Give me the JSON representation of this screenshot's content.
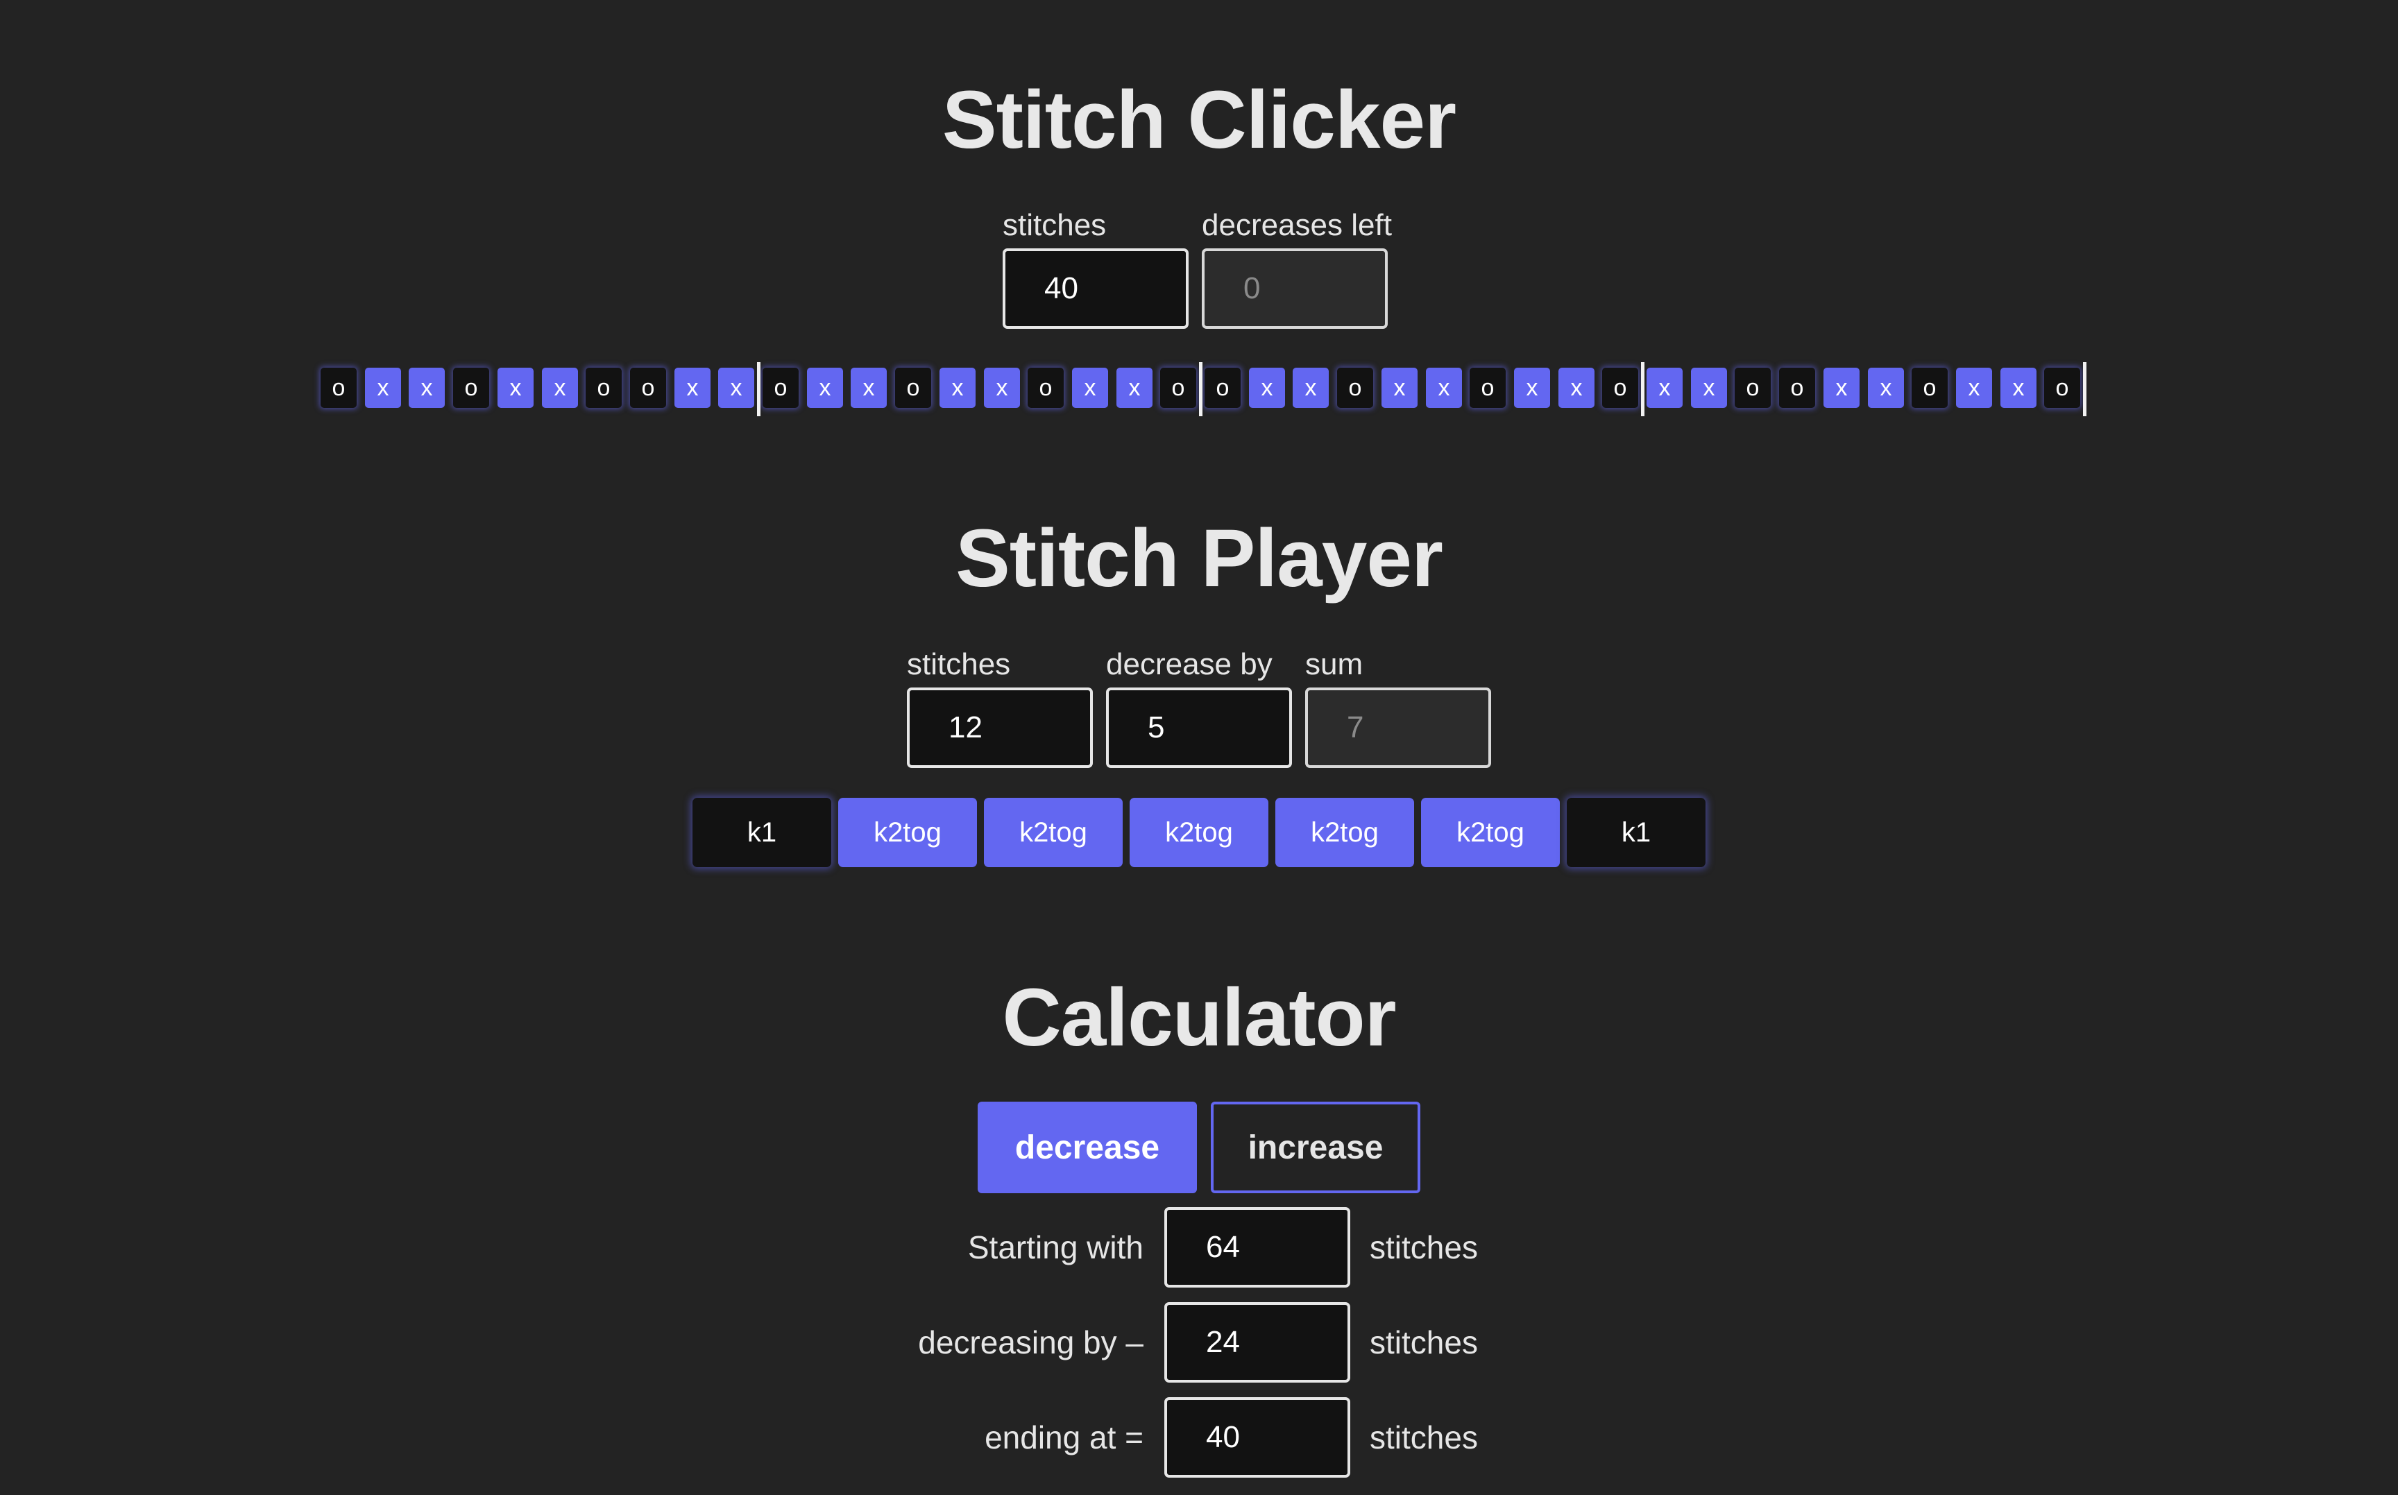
{
  "clicker": {
    "title": "Stitch Clicker",
    "stitches_label": "stitches",
    "stitches_value": "40",
    "decreases_label": "decreases left",
    "decreases_value": "0",
    "row": [
      "o",
      "x",
      "x",
      "o",
      "x",
      "x",
      "o",
      "o",
      "x",
      "x",
      "o",
      "x",
      "x",
      "o",
      "x",
      "x",
      "o",
      "x",
      "x",
      "o",
      "o",
      "x",
      "x",
      "o",
      "x",
      "x",
      "o",
      "x",
      "x",
      "o",
      "x",
      "x",
      "o",
      "o",
      "x",
      "x",
      "o",
      "x",
      "x",
      "o"
    ],
    "divider_after": [
      10,
      20,
      30,
      40
    ]
  },
  "player": {
    "title": "Stitch Player",
    "stitches_label": "stitches",
    "stitches_value": "12",
    "decrease_label": "decrease by",
    "decrease_value": "5",
    "sum_label": "sum",
    "sum_value": "7",
    "steps": [
      "k1",
      "k2tog",
      "k2tog",
      "k2tog",
      "k2tog",
      "k2tog",
      "k1"
    ]
  },
  "calculator": {
    "title": "Calculator",
    "mode_decrease": "decrease",
    "mode_increase": "increase",
    "rows": [
      {
        "label": "Starting with",
        "value": "64",
        "unit": "stitches"
      },
      {
        "label": "decreasing by –",
        "value": "24",
        "unit": "stitches"
      },
      {
        "label": "ending at =",
        "value": "40",
        "unit": "stitches"
      }
    ]
  },
  "colors": {
    "accent": "#6367f1",
    "background": "#232323",
    "field": "#121212"
  }
}
